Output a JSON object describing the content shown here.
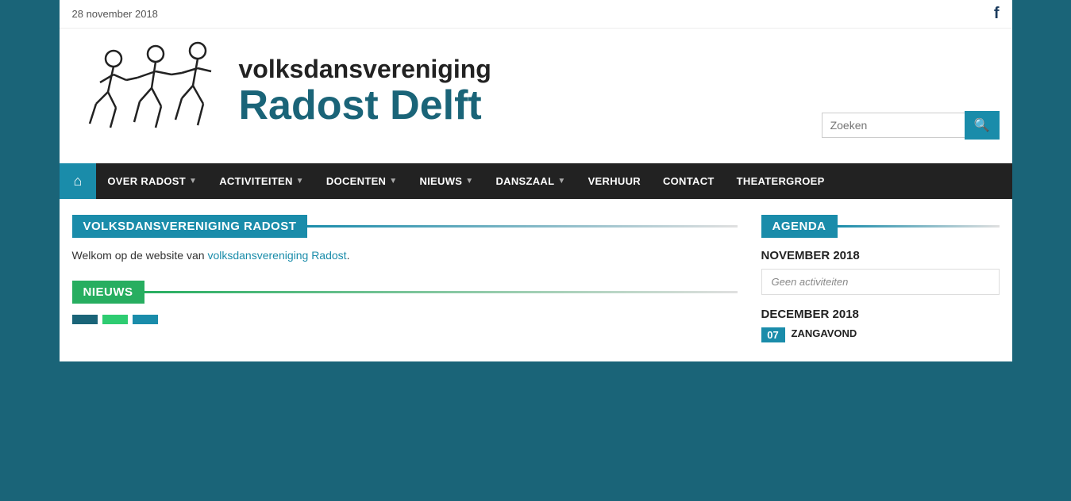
{
  "top_bar": {
    "date": "28 november 2018",
    "facebook_label": "f"
  },
  "header": {
    "title_top": "volksdansvereniging",
    "title_bottom": "Radost Delft",
    "search_placeholder": "Zoeken"
  },
  "nav": {
    "home_icon": "⌂",
    "items": [
      {
        "label": "OVER RADOST",
        "has_arrow": true
      },
      {
        "label": "ACTIVITEITEN",
        "has_arrow": true
      },
      {
        "label": "DOCENTEN",
        "has_arrow": true
      },
      {
        "label": "NIEUWS",
        "has_arrow": true
      },
      {
        "label": "DANSZAAL",
        "has_arrow": true
      },
      {
        "label": "VERHUUR",
        "has_arrow": false
      },
      {
        "label": "CONTACT",
        "has_arrow": false
      },
      {
        "label": "THEATERGROEP",
        "has_arrow": false
      }
    ]
  },
  "main": {
    "section_title": "VOLKSDANSVERENIGING RADOST",
    "welcome_text_plain": "Welkom op de website van ",
    "welcome_link": "volksdansvereniging Radost",
    "welcome_end": ".",
    "nieuws_label": "NIEUWS"
  },
  "agenda": {
    "label": "AGENDA",
    "november": {
      "title": "NOVEMBER 2018",
      "no_activities": "Geen activiteiten"
    },
    "december": {
      "title": "DECEMBER 2018",
      "event_date": "07",
      "event_name": "ZANGAVOND"
    }
  }
}
